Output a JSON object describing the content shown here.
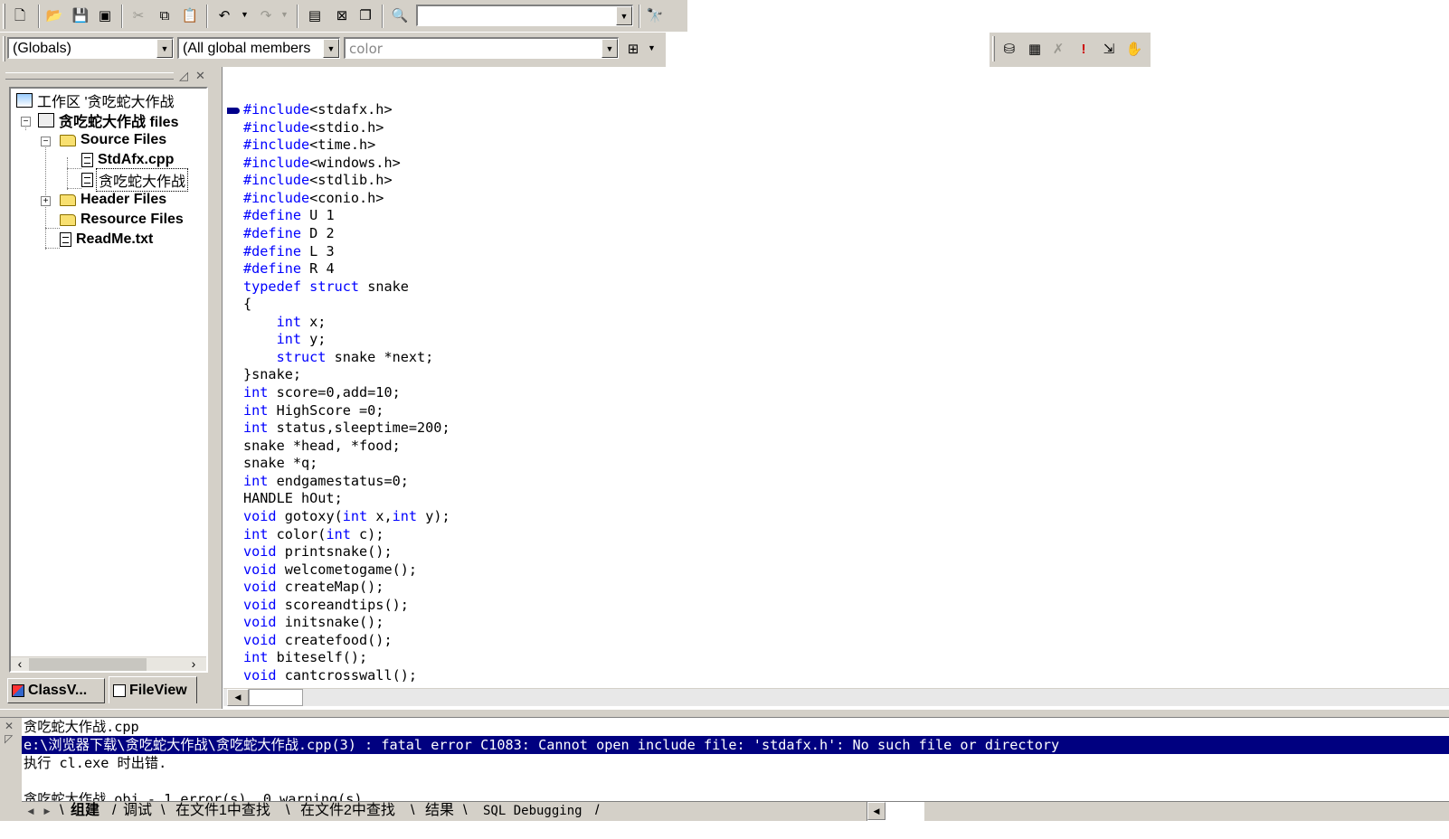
{
  "toolbar": {
    "find_value": "",
    "icons": [
      "new-file-icon",
      "open-icon",
      "save-icon",
      "save-all-icon",
      "cut-icon",
      "copy-icon",
      "paste-icon",
      "undo-icon",
      "redo-icon",
      "workspace-icon",
      "output-icon",
      "window-list-icon",
      "find-in-files-icon",
      "find-icon"
    ]
  },
  "wizardbar": {
    "class_combo": "(Globals)",
    "filter_combo": "(All global members",
    "members_combo": "color"
  },
  "workspace": {
    "nodes": [
      {
        "label": "工作区 '贪吃蛇大作战"
      },
      {
        "label": "贪吃蛇大作战 files"
      },
      {
        "label": "Source Files"
      },
      {
        "label": "StdAfx.cpp"
      },
      {
        "label": "贪吃蛇大作战"
      },
      {
        "label": "Header Files"
      },
      {
        "label": "Resource Files"
      },
      {
        "label": "ReadMe.txt"
      }
    ],
    "tabs": {
      "classview": "ClassV...",
      "fileview": "FileView"
    }
  },
  "editor": {
    "lines": [
      "#include<stdafx.h>",
      "#include<stdio.h>",
      "#include<time.h>",
      "#include<windows.h>",
      "#include<stdlib.h>",
      "#include<conio.h>",
      "#define U 1",
      "#define D 2",
      "#define L 3",
      "#define R 4",
      "typedef struct snake",
      "{",
      "    int x;",
      "    int y;",
      "    struct snake *next;",
      "}snake;",
      "int score=0,add=10;",
      "int HighScore =0;",
      "int status,sleeptime=200;",
      "snake *head, *food;",
      "snake *q;",
      "int endgamestatus=0;",
      "HANDLE hOut;",
      "void gotoxy(int x,int y);",
      "int color(int c);",
      "void printsnake();",
      "void welcometogame();",
      "void createMap();",
      "void scoreandtips();",
      "void initsnake();",
      "void createfood();",
      "int biteself();",
      "void cantcrosswall();"
    ]
  },
  "output": {
    "lines": [
      "贪吃蛇大作战.cpp",
      "e:\\浏览器下载\\贪吃蛇大作战\\贪吃蛇大作战.cpp(3) : fatal error C1083: Cannot open include file: 'stdafx.h': No such file or directory",
      "执行 cl.exe 时出错.",
      "",
      "贪吃蛇大作战.obj - 1 error(s), 0 warning(s)"
    ],
    "tabs": [
      "组建",
      "调试",
      "在文件1中查找",
      "在文件2中查找",
      "结果",
      "SQL Debugging"
    ]
  }
}
